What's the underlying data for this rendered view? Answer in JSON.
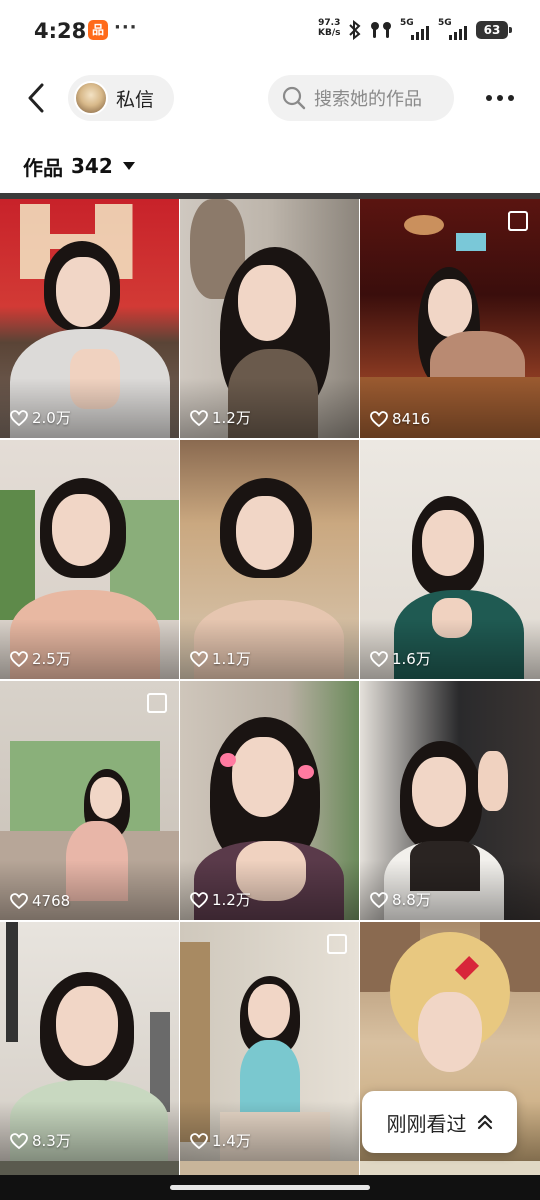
{
  "status_bar": {
    "time": "4:28",
    "app_badge": "品",
    "more": "···",
    "net_speed_value": "97.3",
    "net_speed_unit": "KB/s",
    "signal_1": "5G",
    "signal_2": "5G",
    "battery": "63"
  },
  "header": {
    "dm_label": "私信",
    "search_placeholder": "搜索她的作品"
  },
  "works": {
    "label": "作品",
    "count": "342"
  },
  "tiles": [
    {
      "likes": "2.0万",
      "multi": false
    },
    {
      "likes": "1.2万",
      "multi": false
    },
    {
      "likes": "8416",
      "multi": true
    },
    {
      "likes": "2.5万",
      "multi": false
    },
    {
      "likes": "1.1万",
      "multi": false
    },
    {
      "likes": "1.6万",
      "multi": false
    },
    {
      "likes": "4768",
      "multi": true
    },
    {
      "likes": "1.2万",
      "multi": false
    },
    {
      "likes": "8.8万",
      "multi": false
    },
    {
      "likes": "8.3万",
      "multi": false
    },
    {
      "likes": "1.4万",
      "multi": true
    },
    {
      "likes": "",
      "multi": false
    }
  ],
  "recently_viewed": {
    "label": "刚刚看过"
  },
  "colors": {
    "pill_bg": "#f1f1f1",
    "text": "#111111",
    "placeholder": "#8a8a8a"
  }
}
